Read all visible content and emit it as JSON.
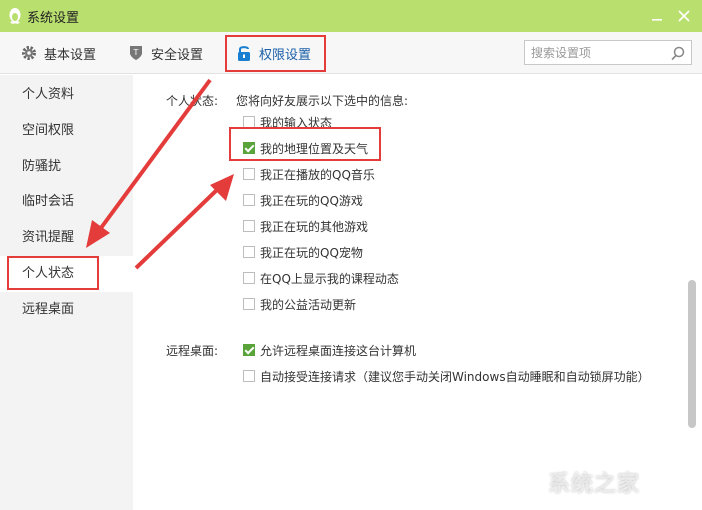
{
  "window": {
    "title": "系统设置"
  },
  "tabs": [
    {
      "label": "基本设置",
      "icon": "gear-icon"
    },
    {
      "label": "安全设置",
      "icon": "shield-icon"
    },
    {
      "label": "权限设置",
      "icon": "lock-icon",
      "active": true
    }
  ],
  "search": {
    "placeholder": "搜索设置项"
  },
  "sidebar": {
    "items": [
      {
        "label": "个人资料"
      },
      {
        "label": "空间权限"
      },
      {
        "label": "防骚扰"
      },
      {
        "label": "临时会话"
      },
      {
        "label": "资讯提醒"
      },
      {
        "label": "个人状态",
        "active": true
      },
      {
        "label": "远程桌面"
      }
    ]
  },
  "personal_status": {
    "label": "个人状态:",
    "description": "您将向好友展示以下选中的信息:",
    "options": [
      {
        "label": "我的输入状态",
        "checked": false
      },
      {
        "label": "我的地理位置及天气",
        "checked": true
      },
      {
        "label": "我正在播放的QQ音乐",
        "checked": false
      },
      {
        "label": "我正在玩的QQ游戏",
        "checked": false
      },
      {
        "label": "我正在玩的其他游戏",
        "checked": false
      },
      {
        "label": "我正在玩的QQ宠物",
        "checked": false
      },
      {
        "label": "在QQ上显示我的课程动态",
        "checked": false
      },
      {
        "label": "我的公益活动更新",
        "checked": false
      }
    ]
  },
  "remote_desktop": {
    "label": "远程桌面:",
    "options": [
      {
        "label": "允许远程桌面连接这台计算机",
        "checked": true
      },
      {
        "label": "自动接受连接请求（建议您手动关闭Windows自动睡眠和自动锁屏功能）",
        "checked": false
      }
    ]
  },
  "watermark": {
    "text": "系统之家"
  },
  "colors": {
    "titlebar": "#b9df6f",
    "highlight": "#e43b3b",
    "check": "#5aa33b",
    "active_tab": "#1a5fa8"
  }
}
